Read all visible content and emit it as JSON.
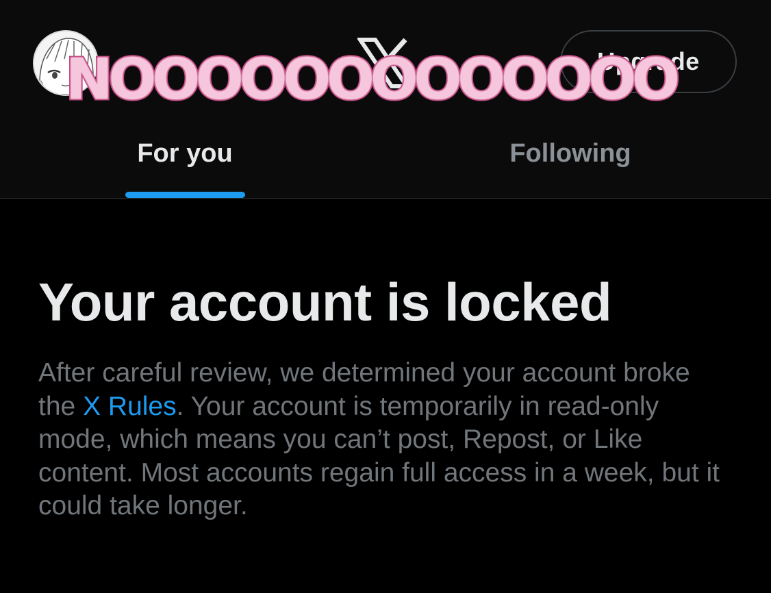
{
  "header": {
    "upgrade_label": "Upgrade",
    "overlay_text": "NOOOOOOOOOOOOO"
  },
  "icons": {
    "logo": "x-logo-icon",
    "avatar": "anime-avatar"
  },
  "tabs": [
    {
      "label": "For you",
      "active": true
    },
    {
      "label": "Following",
      "active": false
    }
  ],
  "notice": {
    "title": "Your account is locked",
    "body_before_link": "After careful review, we determined your account broke the ",
    "link_text": "X Rules",
    "body_after_link": ". Your account is temporarily in read-only mode, which means you can’t post, Repost, or Like content. Most accounts regain full access in a week, but it could take longer."
  },
  "colors": {
    "background": "#000000",
    "header_background": "#0b0b0b",
    "accent": "#1d9bf0",
    "primary_text": "#e7e9ea",
    "secondary_text": "#71767b",
    "overlay_fill": "#f6c6dc",
    "overlay_stroke": "#c2467f"
  }
}
